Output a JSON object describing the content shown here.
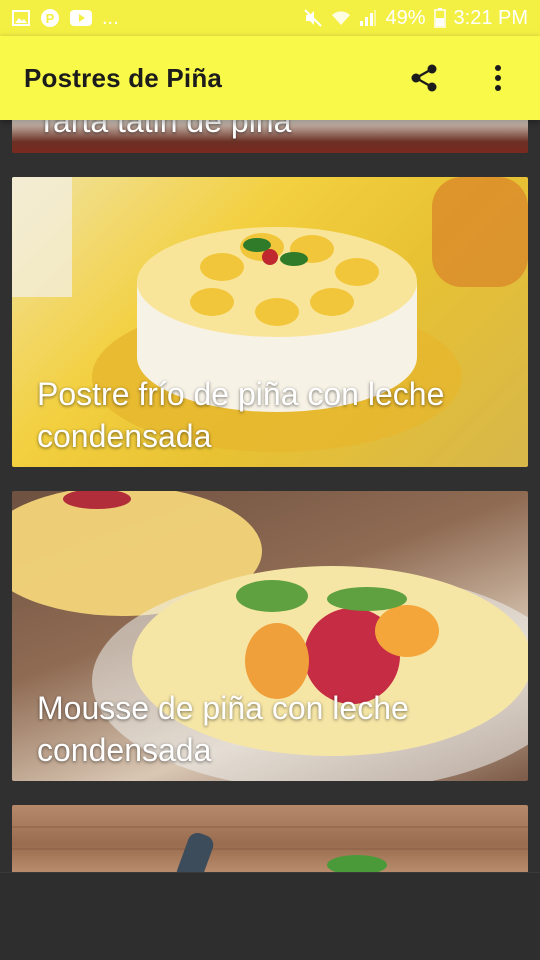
{
  "status_bar": {
    "left_icons": [
      "image-icon",
      "pinterest-icon",
      "youtube-icon"
    ],
    "more": "...",
    "battery_text": "49%",
    "time": "3:21 PM"
  },
  "app_bar": {
    "title": "Postres de Piña",
    "actions": [
      "share-icon",
      "more-vert-icon"
    ]
  },
  "recipes": [
    {
      "title": "Tarta tatin de piña"
    },
    {
      "title": "Postre frío de piña con leche condensada"
    },
    {
      "title": "Mousse de piña con leche condensada"
    },
    {
      "title": ""
    }
  ],
  "colors": {
    "app_bar": "#f9f94a",
    "status_bar": "#f3ef43",
    "background": "#303030"
  }
}
